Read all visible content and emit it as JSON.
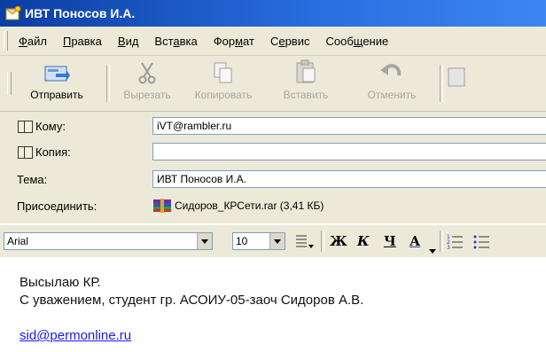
{
  "window": {
    "title": "ИВТ Поносов И.А."
  },
  "menu": [
    {
      "pre": "",
      "key": "Ф",
      "post": "айл"
    },
    {
      "pre": "",
      "key": "П",
      "post": "равка"
    },
    {
      "pre": "",
      "key": "В",
      "post": "ид"
    },
    {
      "pre": "Вст",
      "key": "а",
      "post": "вка"
    },
    {
      "pre": "Фор",
      "key": "м",
      "post": "ат"
    },
    {
      "pre": "С",
      "key": "е",
      "post": "рвис"
    },
    {
      "pre": "Сооб",
      "key": "щ",
      "post": "ение"
    }
  ],
  "toolbar": {
    "send": "Отправить",
    "cut": "Вырезать",
    "copy": "Копировать",
    "paste": "Вставить",
    "undo": "Отменить"
  },
  "header": {
    "to_label": "Кому:",
    "to_value": "iVT@rambler.ru",
    "cc_label": "Копия:",
    "cc_value": "",
    "subject_label": "Тема:",
    "subject_value": "ИВТ Поносов И.А.",
    "attach_label": "Присоединить:",
    "attach_value": "Сидоров_КРСети.rar (3,41 КБ)"
  },
  "format": {
    "font": "Arial",
    "size": "10",
    "bold": "Ж",
    "italic": "К",
    "underline": "Ч",
    "color": "А"
  },
  "message": {
    "line1": "Высылаю КР.",
    "line2": "С уважением, студент гр. АСОИУ-05-заоч Сидоров А.В.",
    "link": "sid@permonline.ru"
  }
}
